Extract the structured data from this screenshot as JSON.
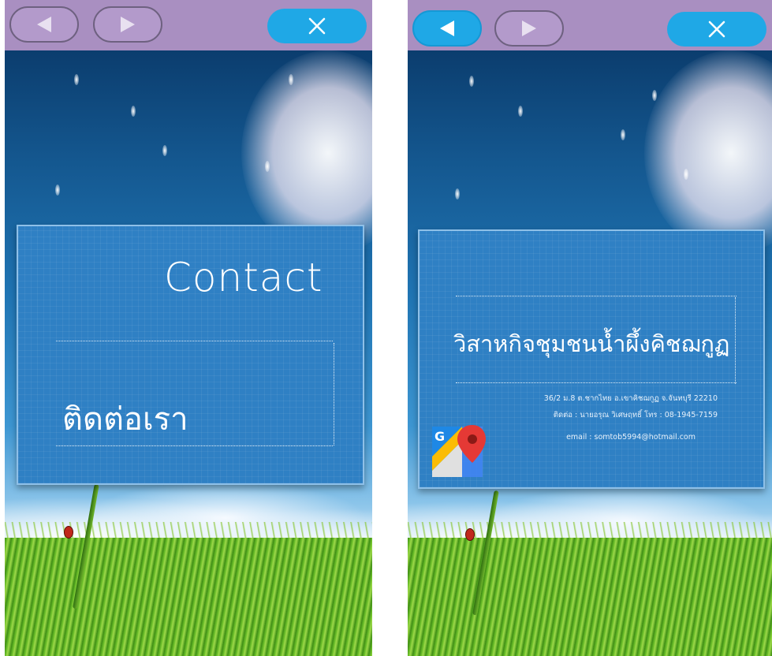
{
  "left_screen": {
    "toolbar": {
      "back_icon": "triangle-left-icon",
      "forward_icon": "triangle-right-icon",
      "close_icon": "close-x-icon"
    },
    "panel": {
      "title": "Contact",
      "subtitle_thai": "ติดต่อเรา"
    }
  },
  "right_screen": {
    "toolbar": {
      "back_icon": "triangle-left-icon",
      "forward_icon": "triangle-right-icon",
      "close_icon": "close-x-icon"
    },
    "panel": {
      "org_name": "วิสาหกิจชุมชนน้ำผึ้งคิชฌกูฏ",
      "address": "36/2 ม.8 ต.ชากไทย อ.เขาคิชฌกูฏ จ.จันทบุรี 22210",
      "contact": "ติดต่อ : นายอรุณ วิเศษฤทธิ์ โทร : 08-1945-7159",
      "email": "email : somtob5994@hotmail.com",
      "map_icon": "google-maps-icon"
    }
  },
  "colors": {
    "toolbar": "#a98fc1",
    "button_active": "#1fa8e6",
    "panel": "#2f80c4"
  }
}
